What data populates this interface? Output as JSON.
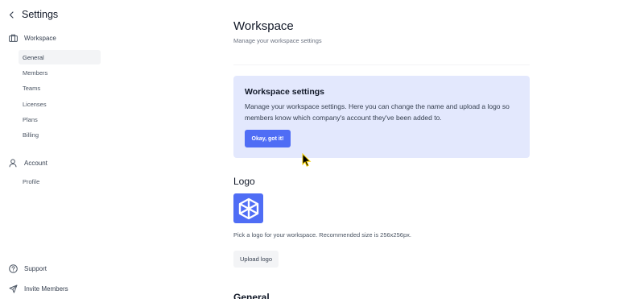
{
  "sidebar": {
    "title": "Settings",
    "workspace_label": "Workspace",
    "workspace_items": [
      {
        "label": "General"
      },
      {
        "label": "Members"
      },
      {
        "label": "Teams"
      },
      {
        "label": "Licenses"
      },
      {
        "label": "Plans"
      },
      {
        "label": "Billing"
      }
    ],
    "account_label": "Account",
    "account_items": [
      {
        "label": "Profile"
      }
    ],
    "footer": {
      "support_label": "Support",
      "invite_label": "Invite Members"
    }
  },
  "main": {
    "title": "Workspace",
    "subtitle": "Manage your workspace settings",
    "callout": {
      "title": "Workspace settings",
      "body": "Manage your workspace settings. Here you can change the name and upload a logo so members know which company's account they've been added to.",
      "button_label": "Okay, got it!"
    },
    "logo_section": {
      "heading": "Logo",
      "hint": "Pick a logo for your workspace. Recommended size is 256x256px.",
      "upload_label": "Upload logo"
    },
    "next_heading_partial": "General"
  },
  "colors": {
    "accent": "#4f6df5",
    "callout_bg": "#e3e8fd",
    "active_item_bg": "#f3f4f6",
    "cursor": "#000000"
  },
  "icons": {
    "back": "chevron-left-icon",
    "workspace": "briefcase-icon",
    "account": "user-icon",
    "support": "help-circle-icon",
    "invite": "send-icon",
    "logo": "cube-icon",
    "pointer": "mouse-cursor-icon"
  }
}
